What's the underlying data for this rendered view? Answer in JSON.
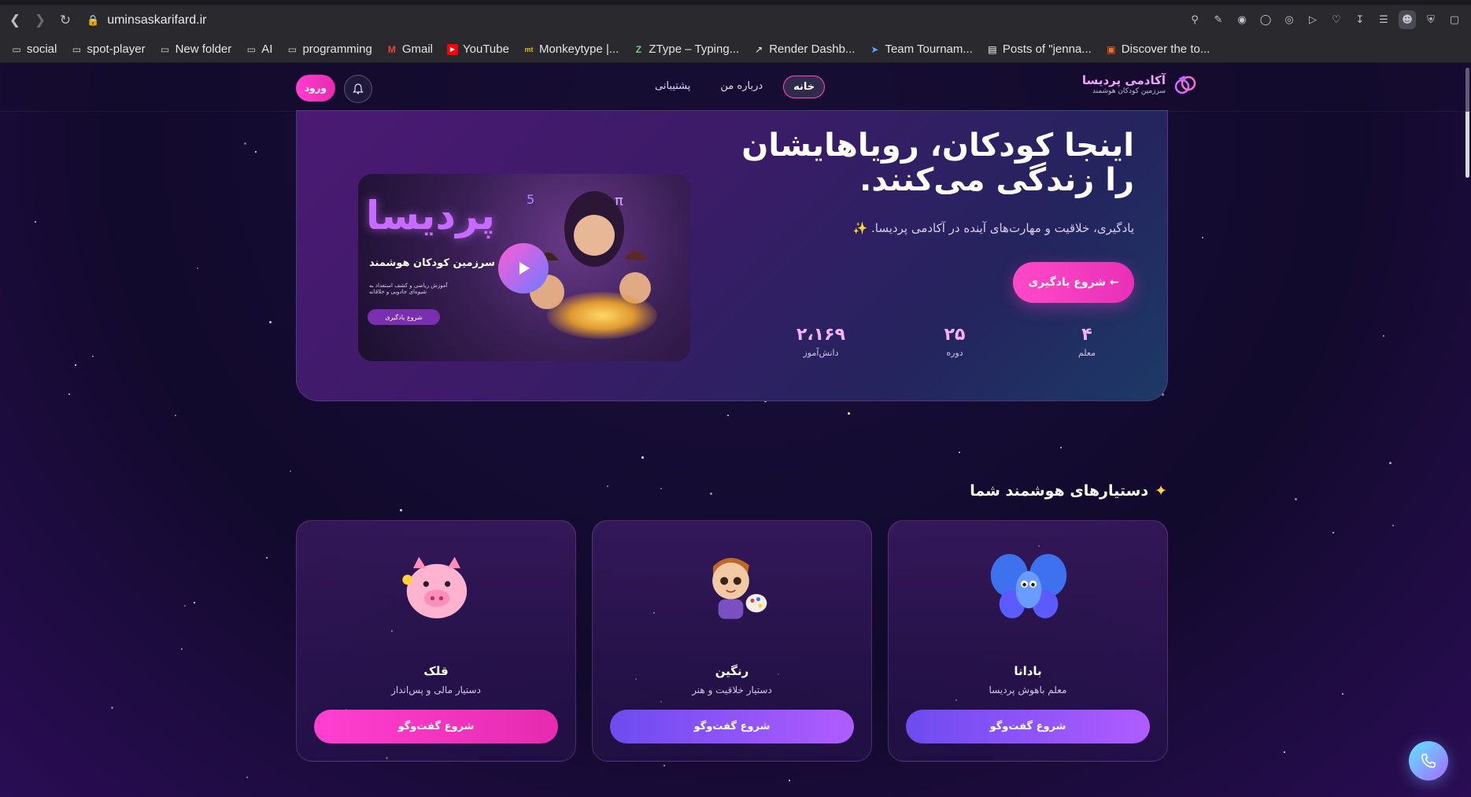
{
  "browser": {
    "url": "uminsaskarifard.ir",
    "bookmarks": [
      {
        "label": "social",
        "icon": "folder-icon"
      },
      {
        "label": "spot-player",
        "icon": "folder-icon"
      },
      {
        "label": "New folder",
        "icon": "folder-icon"
      },
      {
        "label": "AI",
        "icon": "folder-icon"
      },
      {
        "label": "programming",
        "icon": "folder-icon"
      },
      {
        "label": "Gmail",
        "icon": "gmail-icon"
      },
      {
        "label": "YouTube",
        "icon": "youtube-icon"
      },
      {
        "label": "Monkeytype |...",
        "icon": "monkeytype-icon"
      },
      {
        "label": "ZType – Typing...",
        "icon": "ztype-icon"
      },
      {
        "label": "Render Dashb...",
        "icon": "render-icon"
      },
      {
        "label": "Team Tournam...",
        "icon": "team-icon"
      },
      {
        "label": "Posts of \"jenna...",
        "icon": "page-icon"
      },
      {
        "label": "Discover the to...",
        "icon": "discover-icon"
      }
    ]
  },
  "site": {
    "logo_title": "آکادمی پردیسا",
    "logo_subtitle": "سرزمین کودکان هوشمند",
    "nav": {
      "home": "خانه",
      "about": "درباره من",
      "support": "پشتیبانی"
    },
    "login_label": "ورود"
  },
  "hero": {
    "title": "اینجا کودکان، رویاهایشان را زندگی می‌کنند.",
    "subtitle": "یادگیری، خلاقیت و مهارت‌های آینده در آکادمی پردیسا. ✨",
    "cta": "شروع یادگیری ←",
    "stats": {
      "teachers": {
        "value": "۴",
        "label": "معلم"
      },
      "courses": {
        "value": "۲۵",
        "label": "دوره"
      },
      "students": {
        "value": "۲،۱۶۹",
        "label": "دانش‌آموز"
      }
    },
    "video": {
      "brand": "پردیسا",
      "tagline": "سرزمین کودکان هوشمند",
      "small_text": "آموزش ریاضی و کشف استعداد به شیوه‌ای جادویی و خلاقانه",
      "pill": "شروع یادگیری"
    }
  },
  "assistants": {
    "title": "دستیارهای هوشمند شما",
    "cards": [
      {
        "name": "بادانا",
        "desc": "معلم باهوش پردیسا",
        "button": "شروع گفت‌وگو"
      },
      {
        "name": "رنگین",
        "desc": "دستیار خلاقیت و هنر",
        "button": "شروع گفت‌وگو"
      },
      {
        "name": "قلک",
        "desc": "دستیار مالی و پس‌انداز",
        "button": "شروع گفت‌وگو"
      }
    ]
  },
  "colors": {
    "accent_pink": "#ff49c8",
    "accent_purple": "#9b5cff",
    "bg_dark": "#120a2c"
  }
}
